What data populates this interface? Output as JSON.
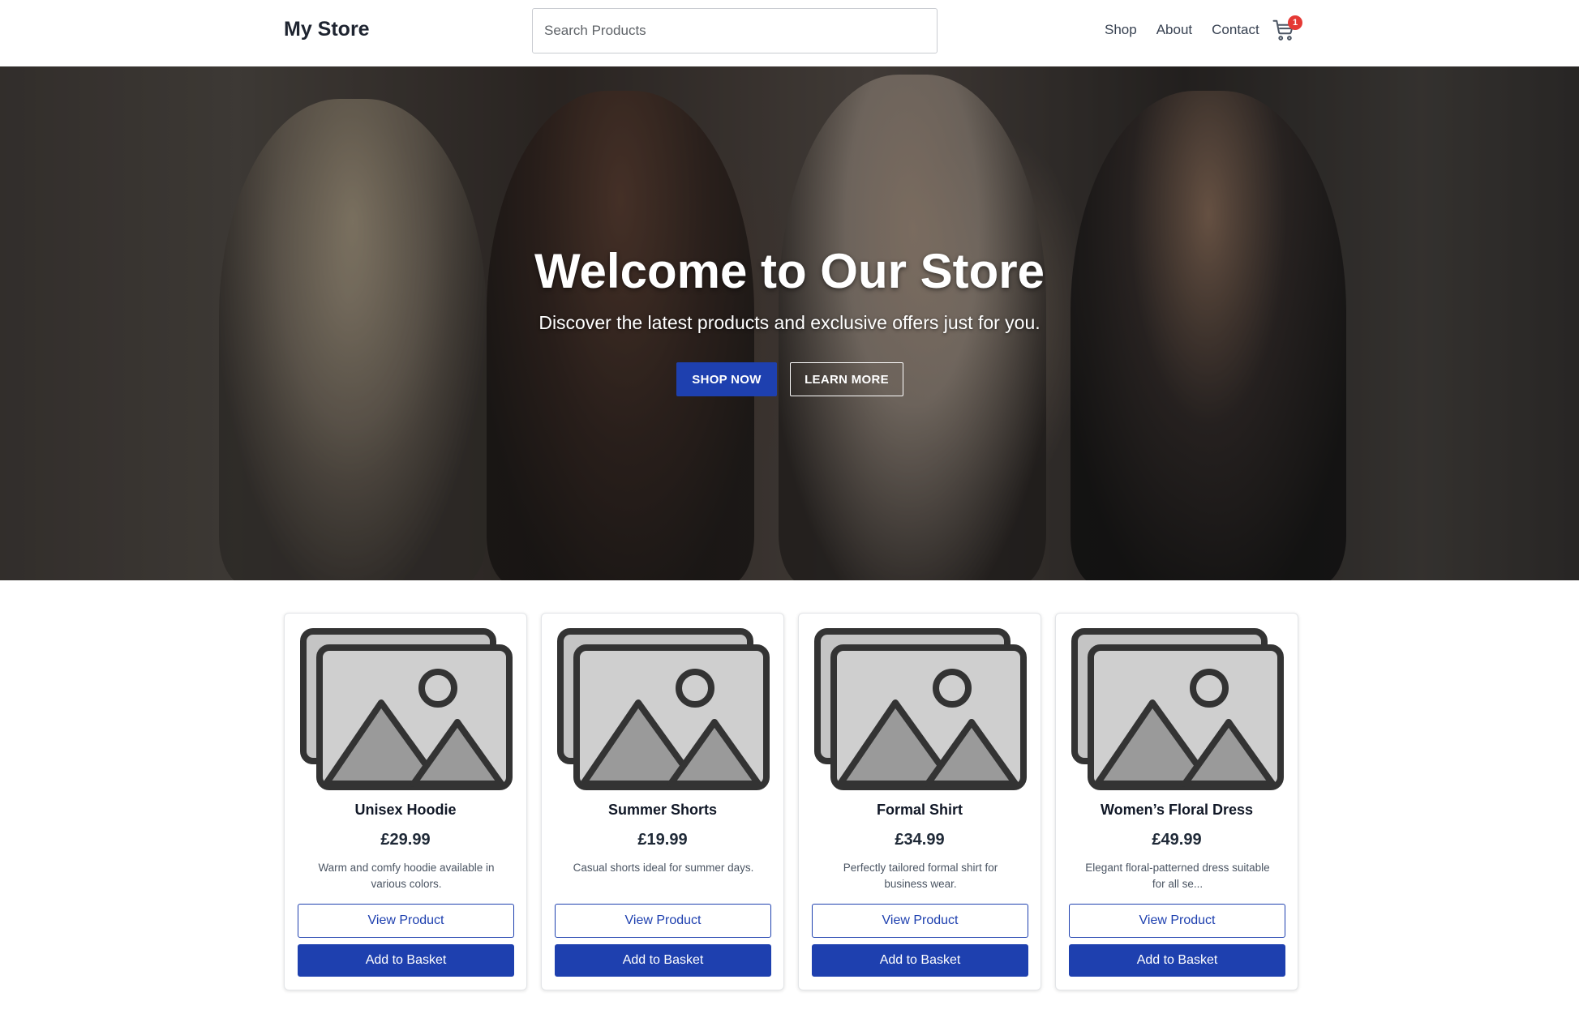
{
  "header": {
    "logo": "My Store",
    "search_placeholder": "Search Products",
    "nav": [
      "Shop",
      "About",
      "Contact"
    ],
    "cart_count": "1",
    "cart_icon": "shopping-cart-icon"
  },
  "hero": {
    "title": "Welcome to Our Store",
    "subtitle": "Discover the latest products and exclusive offers just for you.",
    "primary_button": "SHOP NOW",
    "secondary_button": "LEARN MORE"
  },
  "products": [
    {
      "name": "Unisex Hoodie",
      "price": "£29.99",
      "description": "Warm and comfy hoodie available in various colors.",
      "view_label": "View Product",
      "add_label": "Add to Basket",
      "image_icon": "image-placeholder-icon"
    },
    {
      "name": "Summer Shorts",
      "price": "£19.99",
      "description": "Casual shorts ideal for summer days.",
      "view_label": "View Product",
      "add_label": "Add to Basket",
      "image_icon": "image-placeholder-icon"
    },
    {
      "name": "Formal Shirt",
      "price": "£34.99",
      "description": "Perfectly tailored formal shirt for business wear.",
      "view_label": "View Product",
      "add_label": "Add to Basket",
      "image_icon": "image-placeholder-icon"
    },
    {
      "name": "Women’s Floral Dress",
      "price": "£49.99",
      "description": "Elegant floral-patterned dress suitable for all se...",
      "view_label": "View Product",
      "add_label": "Add to Basket",
      "image_icon": "image-placeholder-icon"
    }
  ],
  "colors": {
    "primary": "#1e40af",
    "badge": "#e53935",
    "text": "#1f2937"
  }
}
